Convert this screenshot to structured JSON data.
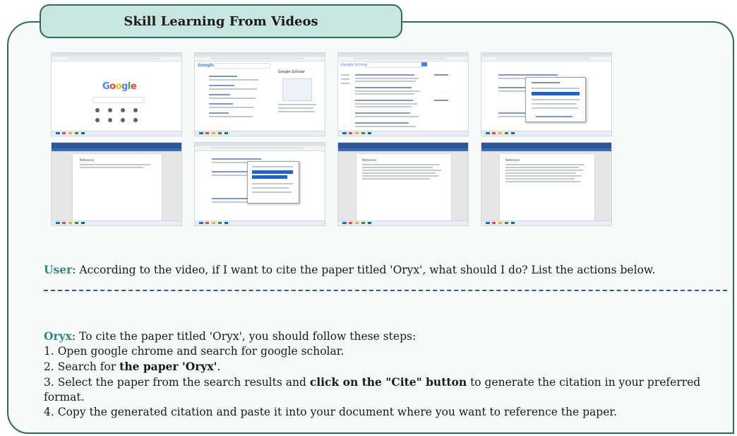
{
  "title": "Skill Learning From Videos",
  "user": {
    "speaker": "User",
    "question": ": According to the video, if I want to cite the paper titled 'Oryx', what should I do? List the actions below."
  },
  "answer": {
    "speaker": "Oryx",
    "intro": ": To cite the paper titled 'Oryx', you should follow these steps:",
    "step1": "1. Open google chrome and search for google scholar.",
    "step2_pre": "2. Search for ",
    "step2_bold": "the paper 'Oryx'",
    "step2_post": ".",
    "step3_pre": "3. Select the paper from the search results and ",
    "step3_bold": "click on the \"Cite\" button",
    "step3_post": " to generate the citation in your preferred format.",
    "step4": "4. Copy the generated citation and paste it into your document where you want to reference the paper."
  },
  "frames": {
    "f1_logo": [
      "G",
      "o",
      "o",
      "g",
      "l",
      "e"
    ],
    "f2_logo": "Google",
    "f2_heading": "Google Scholar",
    "f3_logo": "Google Scholar",
    "f5_heading": "Reference",
    "f7_heading": "Reference",
    "f8_heading": "Reference"
  },
  "colors": {
    "accent_teal": "#2f8a7e",
    "frame_border": "#2f6a58",
    "title_fill": "#c7e6df",
    "divider": "#2c5a92"
  }
}
